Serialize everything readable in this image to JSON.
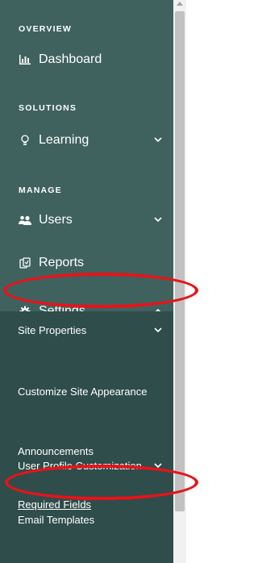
{
  "sections": {
    "overview": "OVERVIEW",
    "solutions": "SOLUTIONS",
    "manage": "MANAGE"
  },
  "nav": {
    "dashboard": "Dashboard",
    "learning": "Learning",
    "users": "Users",
    "reports": "Reports",
    "settings": "Settings"
  },
  "submenu": {
    "site_properties": "Site Properties",
    "customize_site_appearance": "Customize Site Appearance",
    "announcements": "Announcements",
    "user_profile_customization": "User Profile Customization",
    "required_fields": "Required Fields",
    "email_templates": "Email Templates"
  },
  "icons": {
    "dashboard": "bar-chart-icon",
    "learning": "lightbulb-icon",
    "users": "users-icon",
    "reports": "reports-icon",
    "settings": "gear-icon",
    "expand": "chevron-down-icon",
    "collapse": "chevron-up-icon"
  },
  "colors": {
    "sidebar_bg": "#3f625f",
    "submenu_bg": "#2f4d4a",
    "annotation": "#e8131a"
  }
}
